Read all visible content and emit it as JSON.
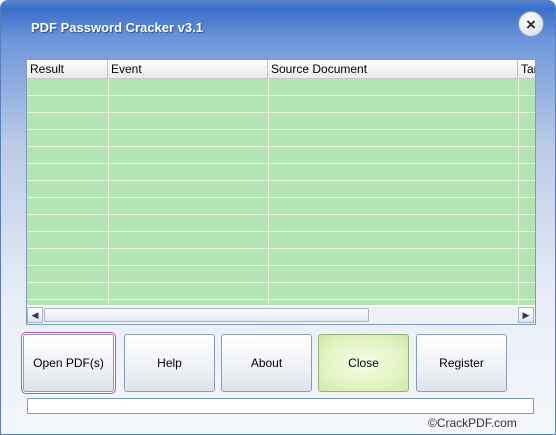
{
  "window": {
    "title": "PDF Password Cracker v3.1",
    "close_glyph": "×"
  },
  "grid": {
    "columns": [
      "Result",
      "Event",
      "Source Document",
      "Tar"
    ],
    "rows": []
  },
  "scrollbar": {
    "left_arrow": "◀",
    "right_arrow": "▶"
  },
  "buttons": {
    "open": "Open PDF(s)",
    "help": "Help",
    "about": "About",
    "close": "Close",
    "register": "Register"
  },
  "status": {
    "text": ""
  },
  "watermark": {
    "text": "©CrackPDF.com"
  }
}
